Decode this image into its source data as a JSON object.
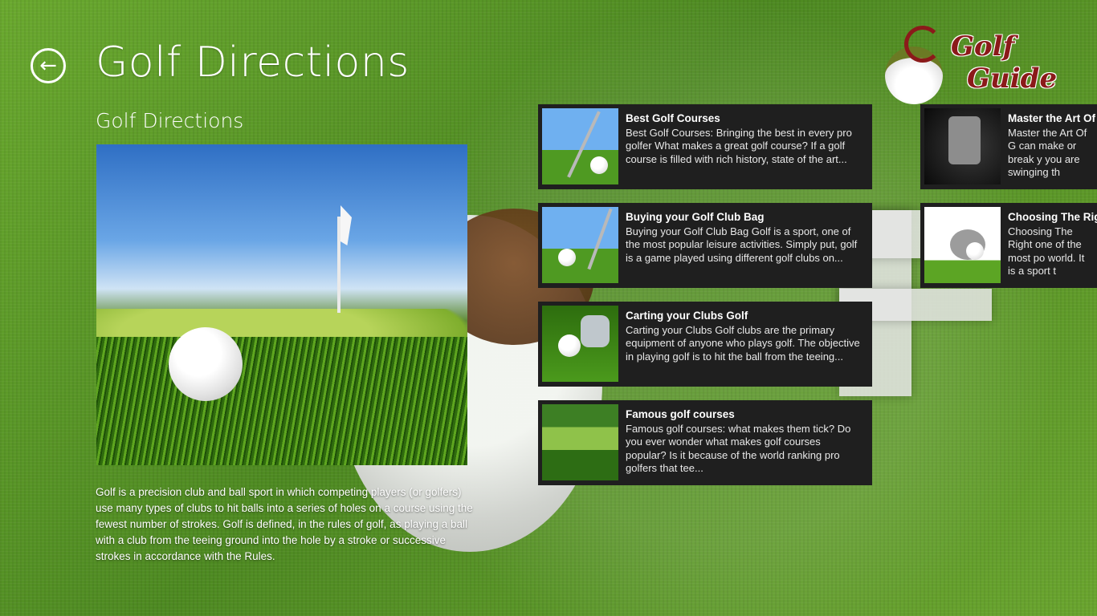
{
  "header": {
    "title": "Golf Directions",
    "back_label": "Back"
  },
  "logo": {
    "line1": "Golf",
    "line2": "Guide"
  },
  "detail": {
    "heading": "Golf Directions",
    "description": "Golf is a precision club and ball sport in which competing players (or golfers) use many types of clubs to hit balls into a series of holes on a course using the fewest number of strokes. Golf is defined, in the rules of golf, as playing a ball with a club from the teeing ground into the hole by a stroke or successive strokes in accordance with the Rules."
  },
  "articles": [
    {
      "title": "Best Golf Courses",
      "desc": "Best Golf Courses: Bringing the best in every pro golfer What makes a great golf course? If a golf course is filled with rich history, state of the art..."
    },
    {
      "title": "Buying your Golf Club Bag",
      "desc": "Buying your Golf Club Bag Golf is a sport, one of the most popular leisure activities. Simply put, golf is a game played using different golf clubs on..."
    },
    {
      "title": "Carting your Clubs Golf",
      "desc": "Carting your Clubs Golf clubs are the primary equipment of anyone who plays golf. The objective in playing golf is to hit the ball from the teeing..."
    },
    {
      "title": "Famous golf courses",
      "desc": "Famous golf courses: what makes them tick? Do you ever wonder what makes golf courses popular? Is it because of the world ranking pro golfers that tee..."
    },
    {
      "title": "Master the Art Of G",
      "desc": "Master the Art Of G can make or break y you are swinging th"
    },
    {
      "title": "Choosing The Righ",
      "desc": "Choosing The Right one of the most po world. It is a sport t"
    }
  ],
  "colors": {
    "card_bg": "#1f1f1f",
    "background": "#5f9a2a",
    "logo_accent": "#8b1a1a"
  }
}
